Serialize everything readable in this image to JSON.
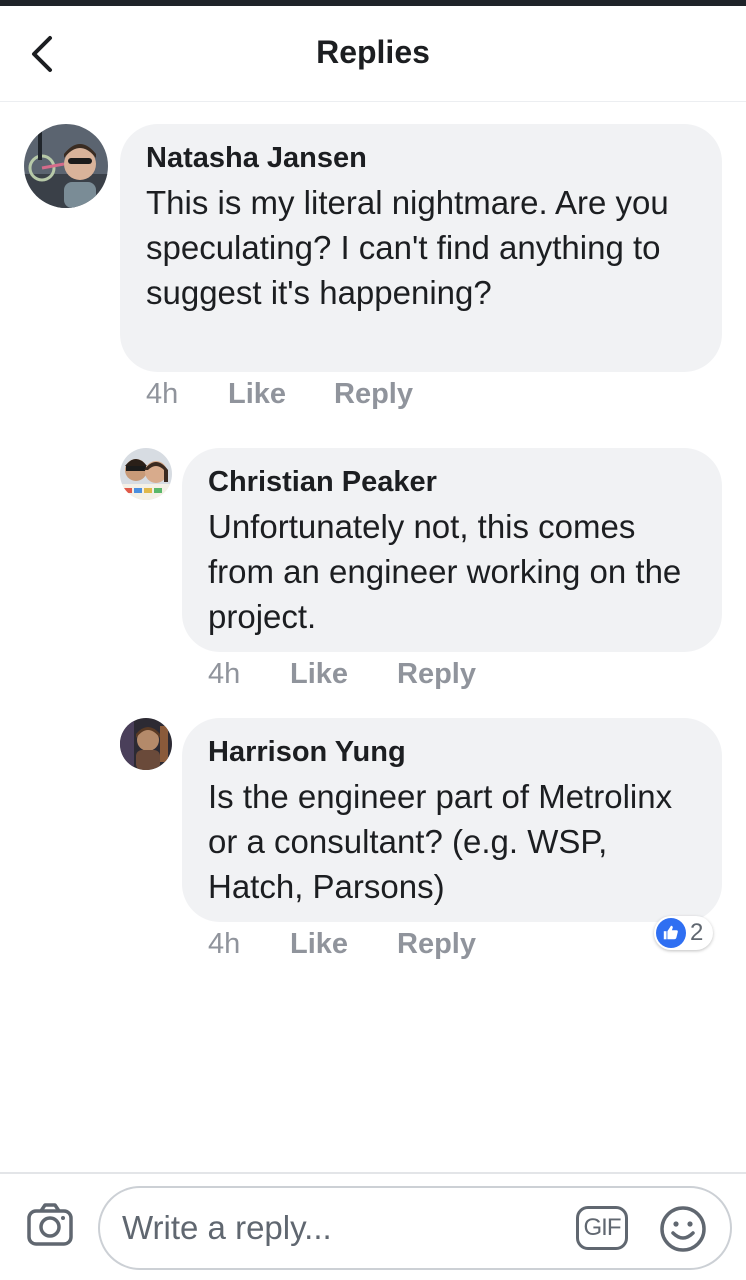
{
  "header": {
    "title": "Replies",
    "back_icon": "chevron-left-icon"
  },
  "comments": [
    {
      "author": "Natasha Jansen",
      "text": "This is my literal nightmare. Are you speculating? I can't find anything to suggest it's happening?",
      "time": "4h",
      "like_label": "Like",
      "reply_label": "Reply"
    },
    {
      "author": "Christian Peaker",
      "text": "Unfortunately not, this comes from an engineer working on the project.",
      "time": "4h",
      "like_label": "Like",
      "reply_label": "Reply"
    },
    {
      "author": "Harrison Yung",
      "text": "Is the engineer part of Metrolinx or a consultant? (e.g. WSP, Hatch, Parsons)",
      "time": "4h",
      "like_label": "Like",
      "reply_label": "Reply",
      "reaction_count": "2",
      "reaction_icon": "thumbs-up-icon"
    }
  ],
  "composer": {
    "placeholder": "Write a reply...",
    "gif_label": "GIF",
    "camera_icon": "camera-icon",
    "emoji_icon": "smiley-icon"
  },
  "colors": {
    "bubble": "#f1f2f4",
    "meta": "#90949c",
    "like_blue": "#2f6ff2"
  }
}
